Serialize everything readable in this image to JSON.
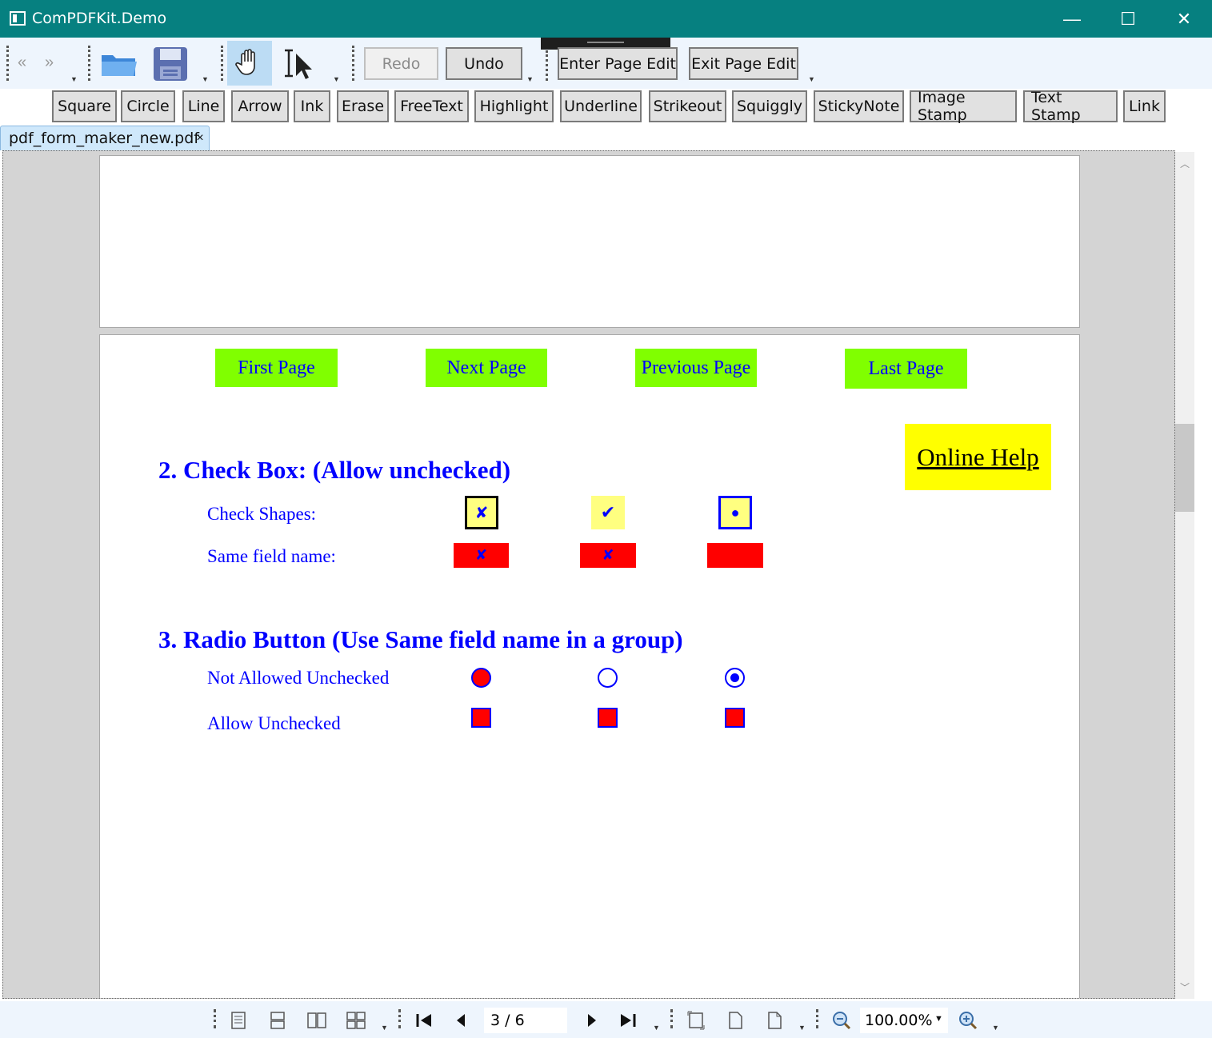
{
  "window": {
    "title": "ComPDFKit.Demo",
    "minimize": "—",
    "maximize": "☐",
    "close": "✕"
  },
  "toolbar": {
    "redo": "Redo",
    "undo": "Undo",
    "enter_page_edit": "Enter Page Edit",
    "exit_page_edit": "Exit Page Edit"
  },
  "annotation_tools": [
    "Square",
    "Circle",
    "Line",
    "Arrow",
    "Ink",
    "Erase",
    "FreeText",
    "Highlight",
    "Underline",
    "Strikeout",
    "Squiggly",
    "StickyNote",
    "Image Stamp",
    "Text Stamp",
    "Link"
  ],
  "tab": {
    "filename": "pdf_form_maker_new.pdf",
    "close": "×"
  },
  "pdf": {
    "nav_buttons": {
      "first": "First Page",
      "next": "Next Page",
      "previous": "Previous Page",
      "last": "Last Page"
    },
    "online_help": "Online Help",
    "checkbox_section": {
      "heading": "2. Check Box: (Allow unchecked)",
      "row1_label": "Check Shapes:",
      "row2_label": "Same field name:",
      "glyphs": {
        "cross": "✘",
        "check": "✔",
        "dot": "●"
      }
    },
    "radio_section": {
      "heading": "3. Radio Button (Use Same field name in a group)",
      "row1_label": "Not Allowed Unchecked",
      "row2_label": "Allow Unchecked"
    }
  },
  "status": {
    "page_indicator": "3 / 6",
    "zoom": "100.00%"
  },
  "colors": {
    "titlebar": "#068080",
    "nav_button": "#80ff00",
    "help": "#ffff00",
    "form_text": "#0000ff",
    "field_red": "#ff0000",
    "field_yellow": "#ffff80"
  }
}
